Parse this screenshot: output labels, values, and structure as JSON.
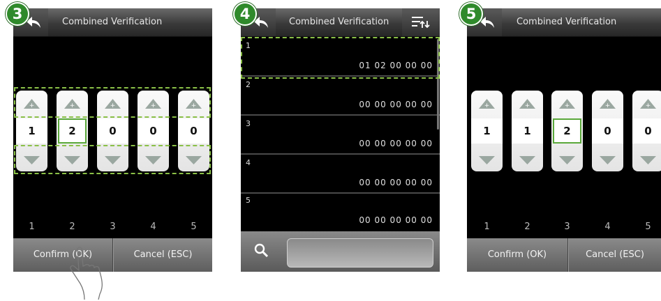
{
  "step3": {
    "badge": "3",
    "title": "Combined Verification",
    "digits": [
      "1",
      "2",
      "0",
      "0",
      "0"
    ],
    "column_numbers": [
      "1",
      "2",
      "3",
      "4",
      "5"
    ],
    "confirm_label": "Confirm (OK)",
    "cancel_label": "Cancel (ESC)"
  },
  "step4": {
    "badge": "4",
    "title": "Combined Verification",
    "rows": [
      {
        "index": "1",
        "code": "01 02 00 00 00"
      },
      {
        "index": "2",
        "code": "00 00 00 00 00"
      },
      {
        "index": "3",
        "code": "00 00 00 00 00"
      },
      {
        "index": "4",
        "code": "00 00 00 00 00"
      },
      {
        "index": "5",
        "code": "00 00 00 00 00"
      }
    ],
    "search_value": ""
  },
  "step5": {
    "badge": "5",
    "title": "Combined Verification",
    "digits": [
      "1",
      "1",
      "2",
      "0",
      "0"
    ],
    "column_numbers": [
      "1",
      "2",
      "3",
      "4",
      "5"
    ],
    "confirm_label": "Confirm (OK)",
    "cancel_label": "Cancel (ESC)"
  },
  "colors": {
    "accent_green": "#2f8a2b",
    "highlight_dash": "#8ac047",
    "selection": "#5aa83a"
  },
  "icons": [
    "back-arrow-icon",
    "sort-list-icon",
    "search-icon",
    "triangle-up-icon",
    "triangle-down-icon",
    "hand-pointer-icon"
  ]
}
